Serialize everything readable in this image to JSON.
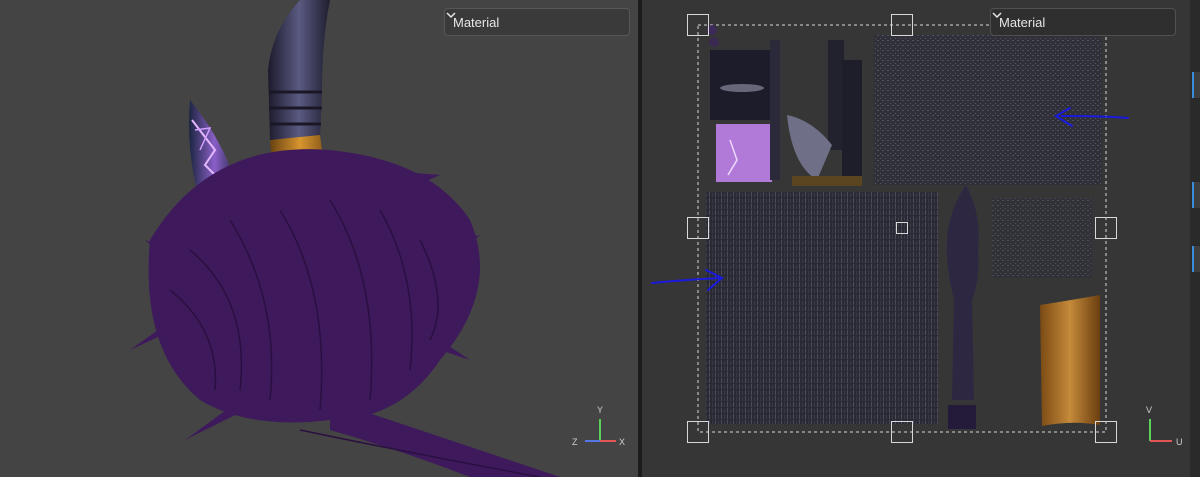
{
  "viewport": {
    "material_select": {
      "selected": "Material"
    },
    "gizmo": {
      "x_label": "X",
      "y_label": "Y",
      "z_label": "Z"
    }
  },
  "uv_editor": {
    "material_select": {
      "selected": "Material"
    },
    "gizmo": {
      "u_label": "U",
      "v_label": "V"
    }
  },
  "colors": {
    "fur": "#3e1a5c",
    "arrow": "#1a1adf",
    "accent": "#3b8edb"
  }
}
